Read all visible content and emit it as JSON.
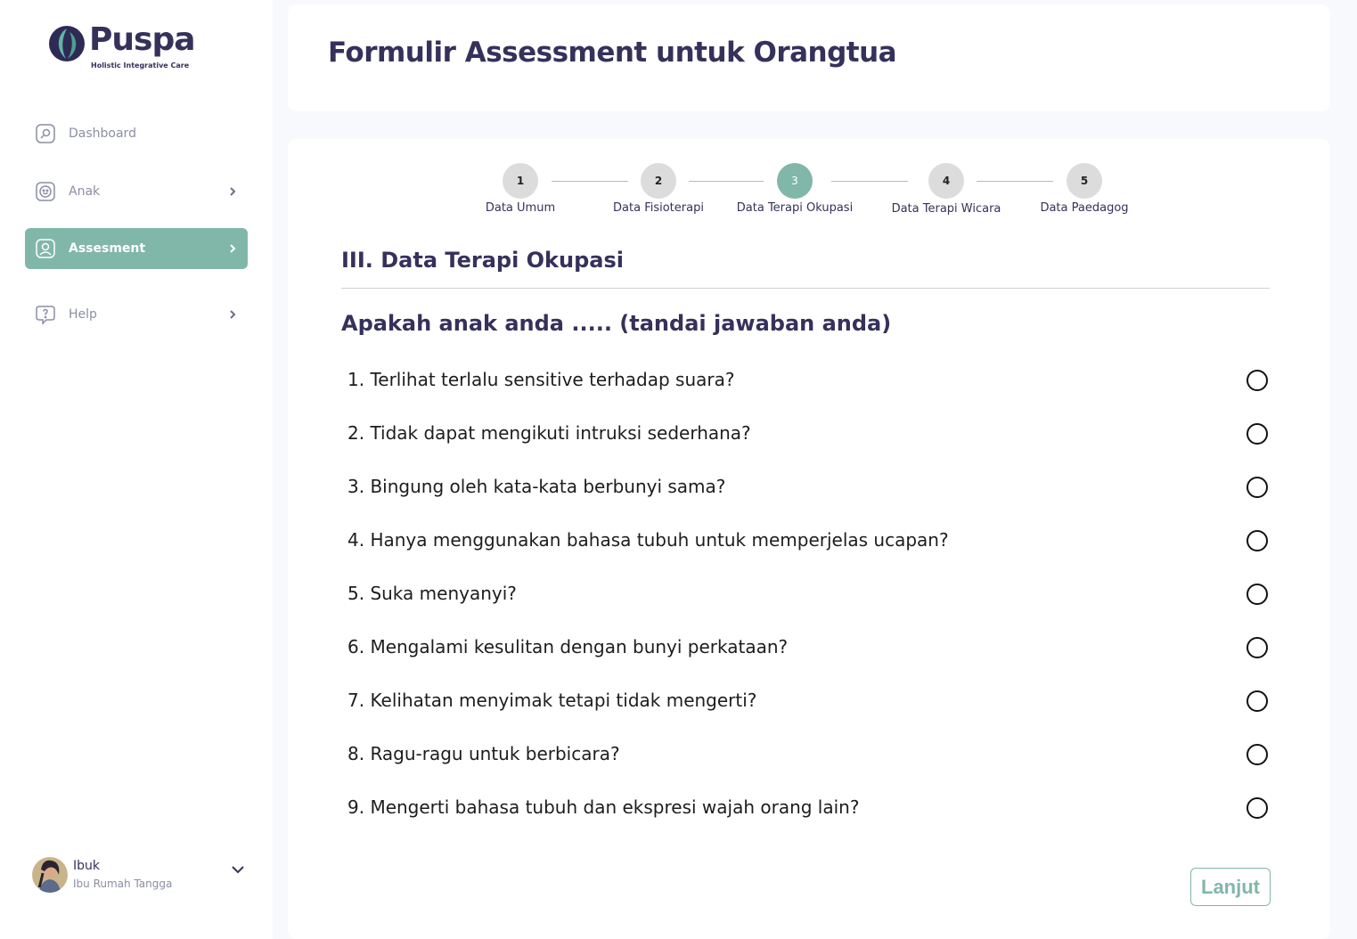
{
  "brand": {
    "name": "Puspa",
    "tagline": "Holistic Integrative Care"
  },
  "sidebar": {
    "items": [
      {
        "label": "Dashboard",
        "icon": "dashboard-icon"
      },
      {
        "label": "Anak",
        "icon": "child-face-icon"
      },
      {
        "label": "Assesment",
        "icon": "user-profile-icon"
      },
      {
        "label": "Help",
        "icon": "help-question-icon"
      }
    ]
  },
  "user": {
    "name": "Ibuk",
    "role": "Ibu Rumah Tangga"
  },
  "header": {
    "title": "Formulir Assessment untuk Orangtua"
  },
  "stepper": {
    "steps": [
      {
        "number": "1",
        "label": "Data Umum"
      },
      {
        "number": "2",
        "label": "Data Fisioterapi"
      },
      {
        "number": "3",
        "label": "Data Terapi Okupasi"
      },
      {
        "number": "4",
        "label": "Data Terapi Wicara"
      },
      {
        "number": "5",
        "label": "Data Paedagog"
      }
    ],
    "active_step": 3
  },
  "section": {
    "title": "III. Data Terapi Okupasi",
    "prompt": "Apakah anak anda ..... (tandai jawaban anda)"
  },
  "questions": [
    "1. Terlihat terlalu sensitive terhadap suara?",
    "2. Tidak dapat mengikuti intruksi sederhana?",
    "3. Bingung oleh kata-kata berbunyi sama?",
    "4. Hanya menggunakan bahasa tubuh untuk memperjelas ucapan?",
    "5. Suka menyanyi?",
    "6. Mengalami kesulitan dengan bunyi perkataan?",
    "7. Kelihatan menyimak tetapi tidak mengerti?",
    "8. Ragu-ragu untuk berbicara?",
    "9. Mengerti bahasa tubuh dan ekspresi wajah orang lain?"
  ],
  "actions": {
    "next_label": "Lanjut"
  },
  "colors": {
    "accent": "#81b7a8",
    "brand_dark": "#36315b",
    "muted": "#8b8ea6"
  }
}
